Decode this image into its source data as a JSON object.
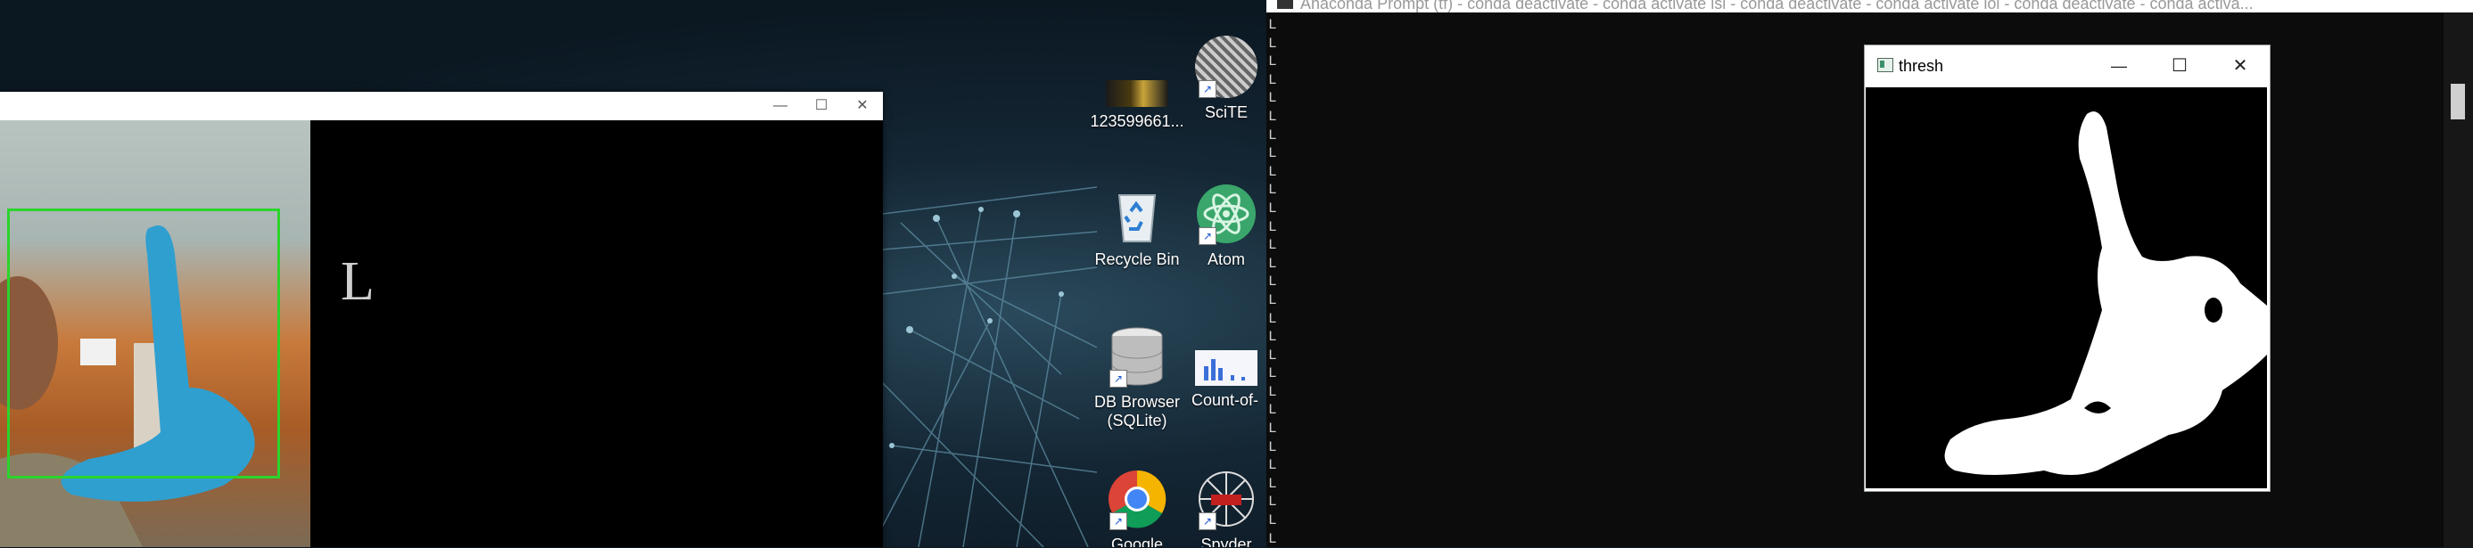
{
  "camera_window": {
    "minimize": "—",
    "maximize": "☐",
    "close": "✕",
    "predicted_letter": "L"
  },
  "desktop_icons": [
    {
      "label": "123599661...",
      "icon": "image-file-icon"
    },
    {
      "label": "SciTE",
      "icon": "scite-icon"
    },
    {
      "label": "Recycle Bin",
      "icon": "recycle-bin-icon"
    },
    {
      "label": "Atom",
      "icon": "atom-icon"
    },
    {
      "label": "DB Browser (SQLite)",
      "icon": "database-icon"
    },
    {
      "label": "Count-of-",
      "icon": "chart-file-icon"
    },
    {
      "label": "Google",
      "icon": "chrome-icon"
    },
    {
      "label": "Spyder",
      "icon": "spyder-icon"
    }
  ],
  "console": {
    "title": "Anaconda Prompt (tf) - conda deactivate - conda activate isl - conda deactivate - conda activate lol - conda deactivate - conda activa...",
    "line_char": "L",
    "colors": {
      "background": "#0c0c0c",
      "text": "#cfcfcf"
    }
  },
  "thresh_window": {
    "title": "thresh",
    "minimize": "—",
    "maximize": "☐",
    "close": "✕"
  }
}
